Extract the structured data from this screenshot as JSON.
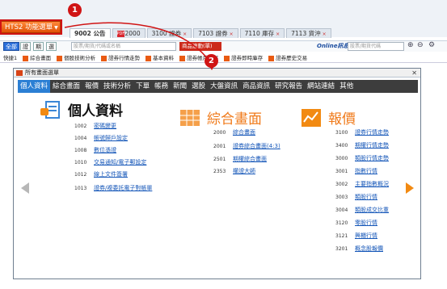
{
  "window": {
    "menu_button": "HTS2 功能選單"
  },
  "tabs": [
    {
      "label": "9002 公告",
      "active": true
    },
    {
      "label": "2000",
      "pdf": true
    },
    {
      "label": "3100 證券"
    },
    {
      "label": "7103 證券"
    },
    {
      "label": "7110 庫存"
    },
    {
      "label": "7113 貨沖"
    }
  ],
  "tab_pdf_label": "PDF",
  "market_buttons": [
    "全部",
    "證",
    "期",
    "選"
  ],
  "search_placeholder": "股票/期貨/代碼或名稱",
  "quote_dropdown": "商品連動(單)",
  "online_label": "Online訊息",
  "search2_placeholder": "股票/期貨代碼",
  "quick_label": "快捷1",
  "quick_items": [
    "綜合畫面",
    "個股技術分析",
    "證券行情走勢",
    "基本資料",
    "證券帳戶庫存",
    "證券即時庫存",
    "證券歷史交易"
  ],
  "dialog": {
    "title": "所有畫面選單",
    "close": "✕"
  },
  "nav": [
    "個人資料",
    "綜合畫面",
    "報價",
    "技術分析",
    "下單",
    "帳務",
    "新聞",
    "選股",
    "大盤資訊",
    "商品資訊",
    "研究報告",
    "網站連結",
    "其他"
  ],
  "sections": {
    "personal": {
      "title": "個人資料",
      "items": [
        {
          "code": "1002",
          "label": "密碼變更"
        },
        {
          "code": "1004",
          "label": "帳號歸戶設定"
        },
        {
          "code": "1008",
          "label": "數位憑證"
        },
        {
          "code": "1010",
          "label": "交易通知/電子郵設定"
        },
        {
          "code": "1012",
          "label": "線上文件簽署"
        },
        {
          "code": "1013",
          "label": "證券/複委託電子對帳單"
        }
      ]
    },
    "overview": {
      "title": "綜合畫面",
      "items": [
        {
          "code": "2000",
          "label": "綜合畫面"
        },
        {
          "code": "2001",
          "label": "證券綜合畫面(4:3)"
        },
        {
          "code": "2501",
          "label": "期權綜合畫面"
        },
        {
          "code": "2353",
          "label": "權證大師"
        }
      ]
    },
    "quote": {
      "title": "報價",
      "items": [
        {
          "code": "3100",
          "label": "證券行情走勢"
        },
        {
          "code": "3400",
          "label": "期權行情走勢"
        },
        {
          "code": "3000",
          "label": "類股行情走勢"
        },
        {
          "code": "3001",
          "label": "指數行情"
        },
        {
          "code": "3002",
          "label": "主要指數概況"
        },
        {
          "code": "3003",
          "label": "類股行情"
        },
        {
          "code": "3004",
          "label": "類股成交比重"
        },
        {
          "code": "3120",
          "label": "零股行情"
        },
        {
          "code": "3121",
          "label": "興櫃行情"
        },
        {
          "code": "3201",
          "label": "概念股報價"
        }
      ]
    }
  },
  "callouts": [
    "1",
    "2"
  ],
  "colors": {
    "accent_red": "#d01414",
    "nav_active": "#2b7fd4",
    "orange": "#f07a1a",
    "link": "#1456b8"
  }
}
